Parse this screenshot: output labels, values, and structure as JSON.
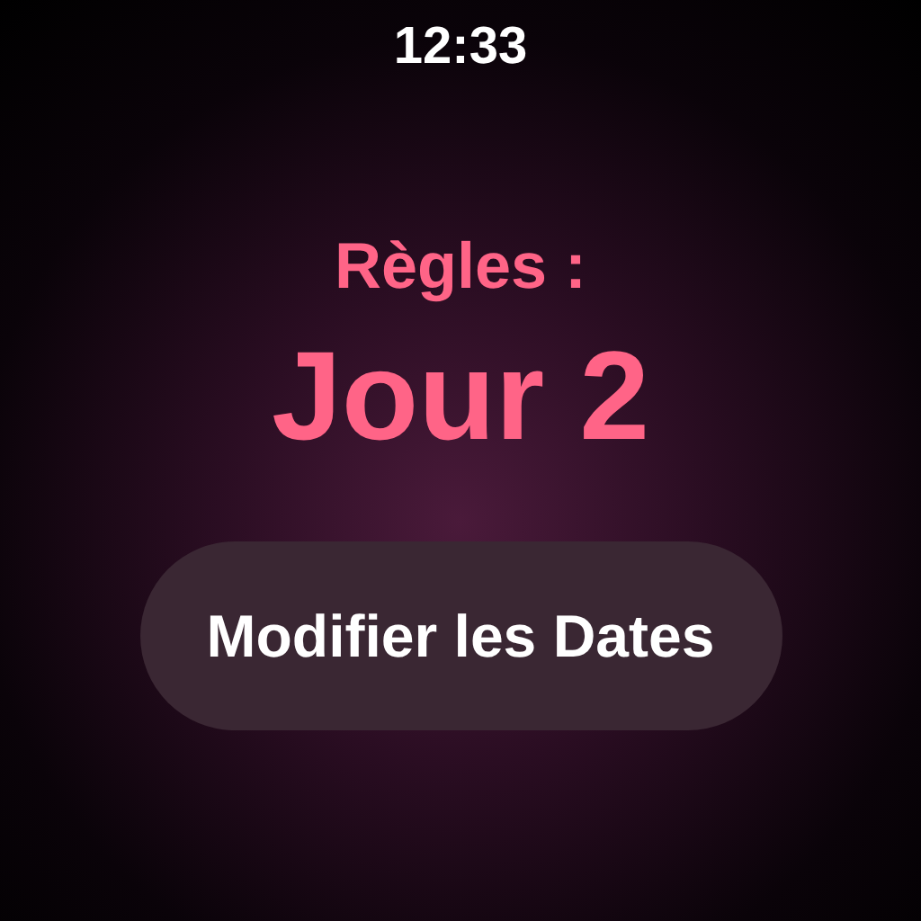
{
  "status_bar": {
    "time": "12:33"
  },
  "period": {
    "label": "Règles :",
    "day": "Jour 2"
  },
  "button": {
    "label": "Modifier les Dates"
  }
}
